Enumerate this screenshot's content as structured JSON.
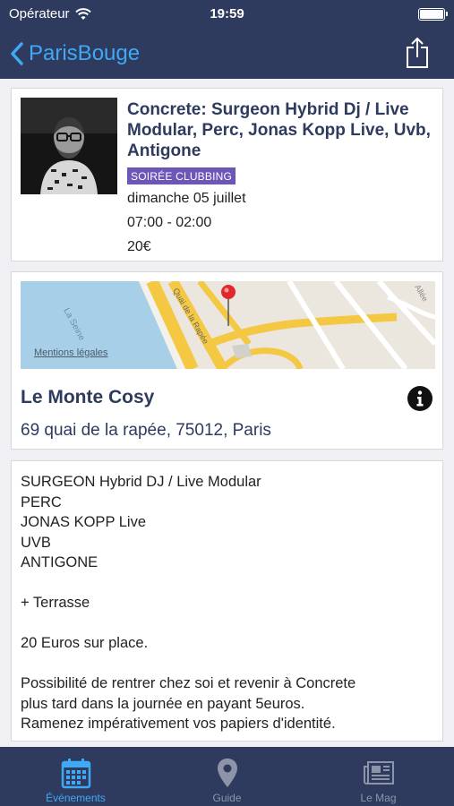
{
  "status_bar": {
    "carrier": "Opérateur",
    "time": "19:59"
  },
  "nav": {
    "back_label": "ParisBouge"
  },
  "event": {
    "title": "Concrete: Surgeon Hybrid Dj / Live Modular, Perc, Jonas Kopp Live, Uvb, Antigone",
    "category": "SOIRÉE CLUBBING",
    "date": "dimanche 05 juillet",
    "hours": "07:00 - 02:00",
    "price": "20€"
  },
  "map": {
    "label_seine": "La Seine",
    "label_street": "Quai de la Rapée",
    "label_allee": "Allée",
    "mentions": "Mentions légales"
  },
  "place": {
    "name": "Le Monte Cosy",
    "address": "69 quai de la rapée, 75012, Paris"
  },
  "description": {
    "lines": [
      "SURGEON Hybrid DJ / Live Modular",
      "PERC",
      "JONAS KOPP Live",
      "UVB",
      "ANTIGONE",
      "",
      "+ Terrasse",
      "",
      "20 Euros sur place.",
      "",
      "Possibilité de rentrer chez soi et revenir à Concrete",
      "plus tard dans la journée en payant 5euros.",
      "Ramenez impérativement vos papiers d'identité."
    ]
  },
  "tabs": [
    {
      "label": "Événements",
      "icon": "calendar-icon",
      "active": true
    },
    {
      "label": "Guide",
      "icon": "map-pin-icon",
      "active": false
    },
    {
      "label": "Le Mag",
      "icon": "newspaper-icon",
      "active": false
    }
  ],
  "colors": {
    "nav_bg": "#2e3b5e",
    "accent": "#3fa9f5",
    "title": "#2e3b5e",
    "badge": "#6c56b8"
  }
}
